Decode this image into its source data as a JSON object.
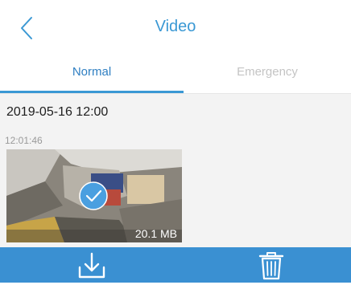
{
  "header": {
    "title": "Video",
    "back_icon": "chevron-left-icon"
  },
  "tabs": [
    {
      "label": "Normal",
      "active": true
    },
    {
      "label": "Emergency",
      "active": false
    }
  ],
  "videos": {
    "group_date": "2019-05-16 12:00",
    "clip": {
      "time": "12:01:46",
      "size": "20.1 MB",
      "selected": true,
      "selected_icon": "checkmark-circle-icon"
    }
  },
  "toolbar": {
    "download_icon": "download-icon",
    "delete_icon": "trash-icon"
  },
  "colors": {
    "accent": "#3a98d4",
    "toolbar": "#3a90d2",
    "inactive_tab": "#c4c4c4",
    "content_bg": "#f3f3f3"
  }
}
